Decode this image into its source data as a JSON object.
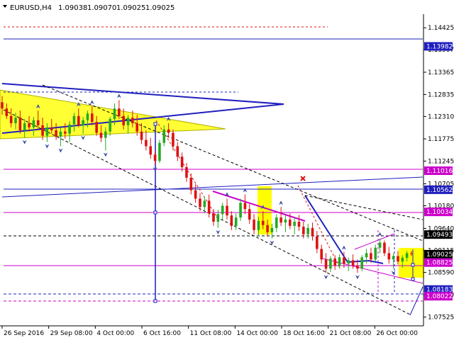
{
  "chart_data": {
    "type": "candlestick",
    "header": {
      "symbol": "EURUSD,H4",
      "open": "1.09038",
      "high": "1.09070",
      "low": "1.09025",
      "close": "1.09025"
    },
    "ylim": [
      1.0735,
      1.1475
    ],
    "y_ticks": [
      "1.14425",
      "1.13907",
      "1.13365",
      "1.12835",
      "1.12310",
      "1.11775",
      "1.11245",
      "1.10705",
      "1.10180",
      "1.09640",
      "1.09115",
      "1.08590",
      "1.08060",
      "1.07525"
    ],
    "x_ticks": [
      "26 Sep 2016",
      "29 Sep 08:00",
      "4 Oct 00:00",
      "6 Oct 16:00",
      "11 Oct 08:00",
      "14 Oct 00:00",
      "18 Oct 16:00",
      "21 Oct 08:00",
      "26 Oct 00:00"
    ],
    "candles": [
      [
        1.1265,
        1.128,
        1.1235,
        1.125
      ],
      [
        1.125,
        1.1262,
        1.1225,
        1.1232
      ],
      [
        1.1232,
        1.125,
        1.1205,
        1.1215
      ],
      [
        1.1215,
        1.124,
        1.12,
        1.1228
      ],
      [
        1.1228,
        1.1245,
        1.119,
        1.1198
      ],
      [
        1.1198,
        1.1225,
        1.118,
        1.1215
      ],
      [
        1.1215,
        1.1232,
        1.1195,
        1.1205
      ],
      [
        1.1205,
        1.123,
        1.1185,
        1.1222
      ],
      [
        1.1222,
        1.1245,
        1.12,
        1.121
      ],
      [
        1.121,
        1.1228,
        1.1175,
        1.1185
      ],
      [
        1.1185,
        1.1215,
        1.117,
        1.1205
      ],
      [
        1.1205,
        1.1225,
        1.119,
        1.1198
      ],
      [
        1.1198,
        1.1215,
        1.1175,
        1.1183
      ],
      [
        1.1183,
        1.1205,
        1.116,
        1.1195
      ],
      [
        1.1195,
        1.1215,
        1.1178,
        1.119
      ],
      [
        1.119,
        1.122,
        1.117,
        1.1212
      ],
      [
        1.1212,
        1.124,
        1.1195,
        1.1232
      ],
      [
        1.1232,
        1.125,
        1.1205,
        1.121
      ],
      [
        1.121,
        1.123,
        1.119,
        1.1222
      ],
      [
        1.1222,
        1.1245,
        1.1205,
        1.1238
      ],
      [
        1.1238,
        1.1255,
        1.121,
        1.1218
      ],
      [
        1.1218,
        1.1232,
        1.1185,
        1.1192
      ],
      [
        1.1192,
        1.121,
        1.117,
        1.118
      ],
      [
        1.118,
        1.1205,
        1.115,
        1.1195
      ],
      [
        1.1195,
        1.123,
        1.1185,
        1.1225
      ],
      [
        1.1225,
        1.1262,
        1.121,
        1.125
      ],
      [
        1.125,
        1.127,
        1.1225,
        1.1232
      ],
      [
        1.1232,
        1.125,
        1.12,
        1.121
      ],
      [
        1.121,
        1.1235,
        1.119,
        1.1228
      ],
      [
        1.1228,
        1.1245,
        1.1205,
        1.1215
      ],
      [
        1.1215,
        1.1235,
        1.1185,
        1.1195
      ],
      [
        1.1195,
        1.1215,
        1.1165,
        1.1175
      ],
      [
        1.1175,
        1.1198,
        1.115,
        1.116
      ],
      [
        1.116,
        1.118,
        1.113,
        1.114
      ],
      [
        1.114,
        1.115,
        1.1115,
        1.1125
      ],
      [
        1.1125,
        1.1175,
        1.112,
        1.1168
      ],
      [
        1.1168,
        1.121,
        1.116,
        1.12
      ],
      [
        1.12,
        1.1215,
        1.118,
        1.1192
      ],
      [
        1.1192,
        1.12,
        1.115,
        1.116
      ],
      [
        1.116,
        1.117,
        1.1125,
        1.1135
      ],
      [
        1.1135,
        1.1145,
        1.11,
        1.111
      ],
      [
        1.111,
        1.112,
        1.1075,
        1.1085
      ],
      [
        1.1085,
        1.1095,
        1.1045,
        1.1055
      ],
      [
        1.1055,
        1.107,
        1.1025,
        1.1035
      ],
      [
        1.1035,
        1.1048,
        1.1005,
        1.1015
      ],
      [
        1.1015,
        1.104,
        1.1,
        1.103
      ],
      [
        1.103,
        1.1045,
        1.099,
        1.1
      ],
      [
        1.1,
        1.101,
        1.097,
        1.098
      ],
      [
        1.098,
        1.1008,
        1.0965,
        1.0998
      ],
      [
        1.0998,
        1.1025,
        1.0985,
        1.1018
      ],
      [
        1.1018,
        1.1035,
        1.0985,
        1.0995
      ],
      [
        1.0995,
        1.1005,
        1.096,
        1.097
      ],
      [
        1.097,
        1.1,
        1.096,
        1.099
      ],
      [
        1.099,
        1.1035,
        1.0982,
        1.1025
      ],
      [
        1.1025,
        1.1045,
        1.0998,
        1.101
      ],
      [
        1.101,
        1.1022,
        1.0975,
        1.0985
      ],
      [
        1.0985,
        1.0998,
        1.095,
        1.096
      ],
      [
        1.096,
        1.0992,
        1.0945,
        1.0982
      ],
      [
        1.0982,
        1.1005,
        1.0962,
        1.0972
      ],
      [
        1.0972,
        1.0985,
        1.0945,
        1.0955
      ],
      [
        1.0955,
        1.0975,
        1.094,
        1.0965
      ],
      [
        1.0965,
        1.0998,
        1.0955,
        1.099
      ],
      [
        1.099,
        1.1015,
        1.097,
        1.0978
      ],
      [
        1.0978,
        1.0995,
        1.0955,
        1.0985
      ],
      [
        1.0985,
        1.1,
        1.0962,
        1.097
      ],
      [
        1.097,
        1.099,
        1.095,
        1.098
      ],
      [
        1.098,
        1.0996,
        1.0958,
        1.0968
      ],
      [
        1.0968,
        1.098,
        1.094,
        1.095
      ],
      [
        1.095,
        1.0975,
        1.094,
        1.0965
      ],
      [
        1.0965,
        1.0978,
        1.0935,
        1.0945
      ],
      [
        1.0945,
        1.0958,
        1.0905,
        1.0915
      ],
      [
        1.0915,
        1.0925,
        1.088,
        1.089
      ],
      [
        1.089,
        1.0905,
        1.0858,
        1.0868
      ],
      [
        1.0868,
        1.0898,
        1.086,
        1.0892
      ],
      [
        1.0892,
        1.09,
        1.0865,
        1.0875
      ],
      [
        1.0875,
        1.0902,
        1.0868,
        1.0895
      ],
      [
        1.0895,
        1.0908,
        1.087,
        1.088
      ],
      [
        1.088,
        1.0895,
        1.0862,
        1.0888
      ],
      [
        1.0888,
        1.0902,
        1.0868,
        1.0875
      ],
      [
        1.0875,
        1.089,
        1.0858,
        1.0868
      ],
      [
        1.0868,
        1.09,
        1.0862,
        1.0895
      ],
      [
        1.0895,
        1.0915,
        1.088,
        1.0905
      ],
      [
        1.0905,
        1.0918,
        1.0882,
        1.089
      ],
      [
        1.089,
        1.0925,
        1.0885,
        1.0918
      ],
      [
        1.0918,
        1.094,
        1.0905,
        1.093
      ],
      [
        1.093,
        1.0935,
        1.0898,
        1.0905
      ],
      [
        1.0905,
        1.092,
        1.088,
        1.089
      ],
      [
        1.089,
        1.0905,
        1.0868,
        1.0898
      ],
      [
        1.0898,
        1.091,
        1.0878,
        1.0885
      ],
      [
        1.0885,
        1.09,
        1.087,
        1.0894
      ],
      [
        1.0894,
        1.091,
        1.0885,
        1.0905
      ],
      [
        1.0905,
        1.091,
        1.0898,
        1.0903
      ]
    ],
    "level_labels": [
      {
        "label": "1.13982",
        "value": 1.13982,
        "color": "#1f1fbf"
      },
      {
        "label": "1.11016",
        "value": 1.11016,
        "color": "#cc00cc"
      },
      {
        "label": "1.10562",
        "value": 1.10562,
        "color": "#1f1fbf"
      },
      {
        "label": "1.10034",
        "value": 1.10034,
        "color": "#cc00cc"
      },
      {
        "label": "1.09493",
        "value": 1.09493,
        "color": "#000000"
      },
      {
        "label": "1.09025",
        "value": 1.09025,
        "color": "#000000"
      },
      {
        "label": "1.08825",
        "value": 1.08825,
        "color": "#cc00cc"
      },
      {
        "label": "1.08183",
        "value": 1.08183,
        "color": "#1f1fbf"
      },
      {
        "label": "1.08022",
        "value": 1.08022,
        "color": "#cc00cc"
      }
    ],
    "colors": {
      "bull": "#22aa22",
      "bear": "#dd1111",
      "magenta": "#cc00cc",
      "navy": "#1f1fbf",
      "highlight": "#ffff00",
      "grid": "#000000"
    }
  }
}
